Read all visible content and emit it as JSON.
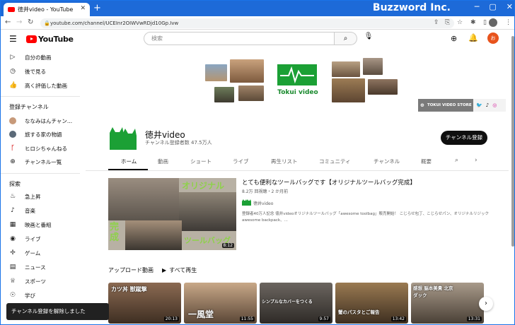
{
  "browser": {
    "tab_title": "徳井video - YouTube",
    "new_tab": "+",
    "url": "youtube.com/channel/UCEInr2OIWVwRDjd10Gp.Ivw",
    "brand": "Buzzword Inc."
  },
  "header": {
    "logo_text": "YouTube",
    "search_placeholder": "検索",
    "avatar_letter": "お"
  },
  "sidebar": {
    "top_items": [
      {
        "label": "自分の動画",
        "icon": "play-box-icon"
      },
      {
        "label": "後で見る",
        "icon": "clock-icon"
      },
      {
        "label": "高く評価した動画",
        "icon": "thumbs-up-icon"
      }
    ],
    "subs_heading": "登録チャンネル",
    "subs": [
      {
        "label": "ななみはんチャン...",
        "color": "#c79a7a"
      },
      {
        "label": "旅する家の物語",
        "color": "#5b6a78"
      },
      {
        "label": "ヒロシちゃんねる",
        "color": "#d33"
      },
      {
        "label": "チャンネル一覧",
        "color": "#fff"
      }
    ],
    "explore_heading": "探索",
    "explore": [
      {
        "label": "急上昇",
        "icon": "fire-icon"
      },
      {
        "label": "音楽",
        "icon": "music-icon"
      },
      {
        "label": "映画と番組",
        "icon": "film-icon"
      },
      {
        "label": "ライブ",
        "icon": "live-icon"
      },
      {
        "label": "ゲーム",
        "icon": "gamepad-icon"
      },
      {
        "label": "ニュース",
        "icon": "news-icon"
      },
      {
        "label": "スポーツ",
        "icon": "trophy-icon"
      },
      {
        "label": "学び",
        "icon": "bulb-icon"
      }
    ]
  },
  "banner": {
    "logo_text": "Tokui video",
    "store_label": "TOKUI VIDEO STORE"
  },
  "channel": {
    "name": "徳井video",
    "subscribers": "チャンネル登録者数 47.5万人",
    "subscribe_button": "チャンネル登録"
  },
  "tabs": [
    "ホーム",
    "動画",
    "ショート",
    "ライブ",
    "再生リスト",
    "コミュニティ",
    "チャンネル",
    "概要"
  ],
  "featured": {
    "title": "とても便利なツールバッグです【オリジナルツールバッグ完成】",
    "meta": "8.2万 回視聴・2 か月前",
    "channel": "徳井video",
    "description": "登録者40万人記念 徳井videoオリジナルツールバッグ「awesome toolbag」販売開始！ こじらせ包丁、こじらせパン、オリジナルリジックawesome backpack、...",
    "overlay_top": "オリジナル",
    "overlay_left": "完成",
    "overlay_bottom": "ツールバッグ",
    "duration": "8:12"
  },
  "uploads": {
    "heading": "アップロード動画",
    "play_all": "すべて再生",
    "videos": [
      {
        "text": "カツ丼  獣蹴撃",
        "duration": "20:13",
        "bg": "#8b6a52"
      },
      {
        "text": "一風堂",
        "duration": "11:55",
        "bg": "#c8a888"
      },
      {
        "text": "シンプルなカバーをつくる",
        "duration": "9:57",
        "bg": "#6b655f"
      },
      {
        "text": "蟹のパスタとご報告",
        "duration": "13:42",
        "bg": "#9a7a52"
      },
      {
        "text": "感想 脳本美貴 北京ダック",
        "duration": "13:31",
        "bg": "#a89a8a"
      }
    ]
  },
  "toast": "チャンネル登録を解除しました"
}
